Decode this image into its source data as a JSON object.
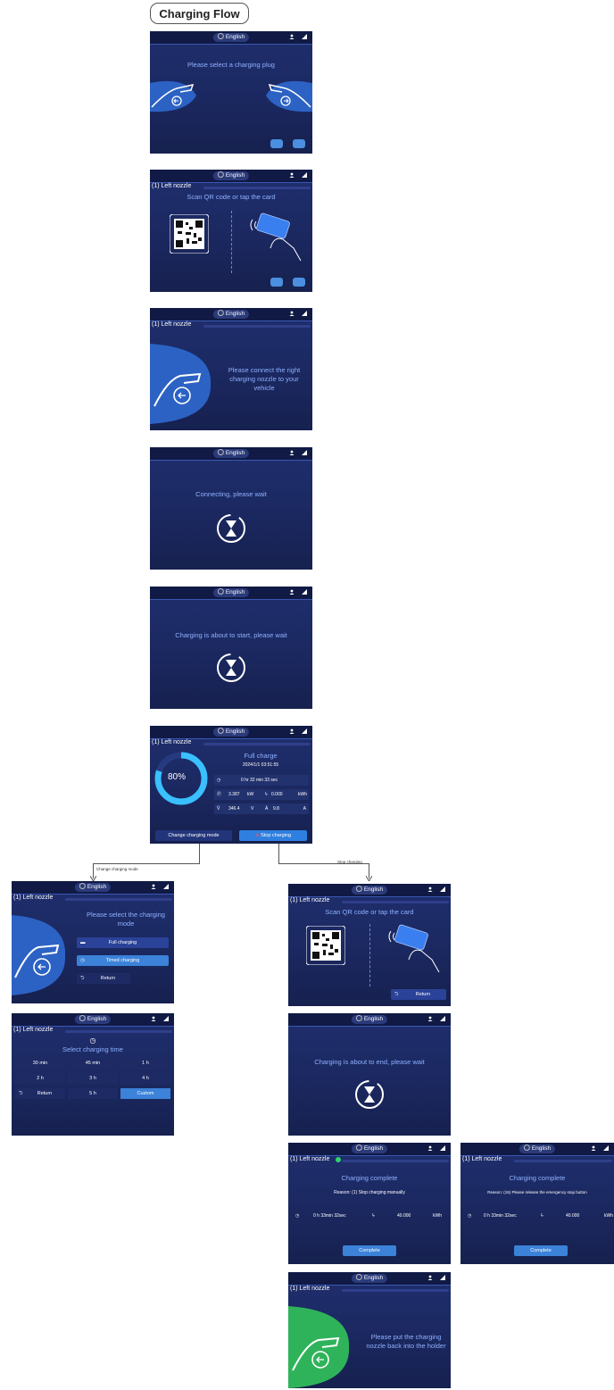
{
  "title": "Charging Flow",
  "common": {
    "language": "English",
    "nozzle": "(1) Left nozzle"
  },
  "s1": {
    "message": "Please select a charging plug"
  },
  "s2": {
    "message": "Scan QR code or tap the card"
  },
  "s3": {
    "message": "Please connect the right charging nozzle to your vehicle"
  },
  "s4": {
    "message": "Connecting, please wait"
  },
  "s5": {
    "message": "Charging is about to start, please wait"
  },
  "s6": {
    "mode": "Full charge",
    "datetime": "2024/1/1 03:51:55",
    "percent": "80%",
    "progress": 0.8,
    "duration": "0 hr 32 min 33 sec",
    "power_value": "3.387",
    "power_unit": "kW",
    "energy_value": "0.000",
    "energy_unit": "kWh",
    "voltage_value": "346.4",
    "voltage_unit": "V",
    "current_value": "9.8",
    "current_unit": "A",
    "change_mode_button": "Change charging mode",
    "stop_button": "Stop charging"
  },
  "branches": {
    "left": "Change charging mode",
    "right": "Stop charging"
  },
  "s7": {
    "message": "Please select the charging mode",
    "opt_full": "Full charging",
    "opt_timed": "Timed charging",
    "return": "Return"
  },
  "s8": {
    "message": "Select charging time",
    "times": [
      "30 min",
      "45 min",
      "1 h",
      "2 h",
      "3 h",
      "4 h"
    ],
    "return": "Return",
    "five": "5 h",
    "custom": "Custom"
  },
  "s9": {
    "message": "Scan QR code or tap the card",
    "return": "Return"
  },
  "s10": {
    "message": "Charging is about to end, please wait"
  },
  "s11": {
    "message": "Charging complete",
    "reason": "Reason:  (1) Stop charging manually",
    "time": "0  h  33min  32sec",
    "energy": "40.000",
    "unit": "kWh",
    "button": "Complete"
  },
  "s12": {
    "message": "Charging complete",
    "reason": "Reason:  (15) Please release the emergency stop button",
    "time": "0  h  33min  32sec",
    "energy": "40.000",
    "unit": "kWh",
    "button": "Complete"
  },
  "s13": {
    "message": "Please put the charging nozzle back into the holder"
  }
}
